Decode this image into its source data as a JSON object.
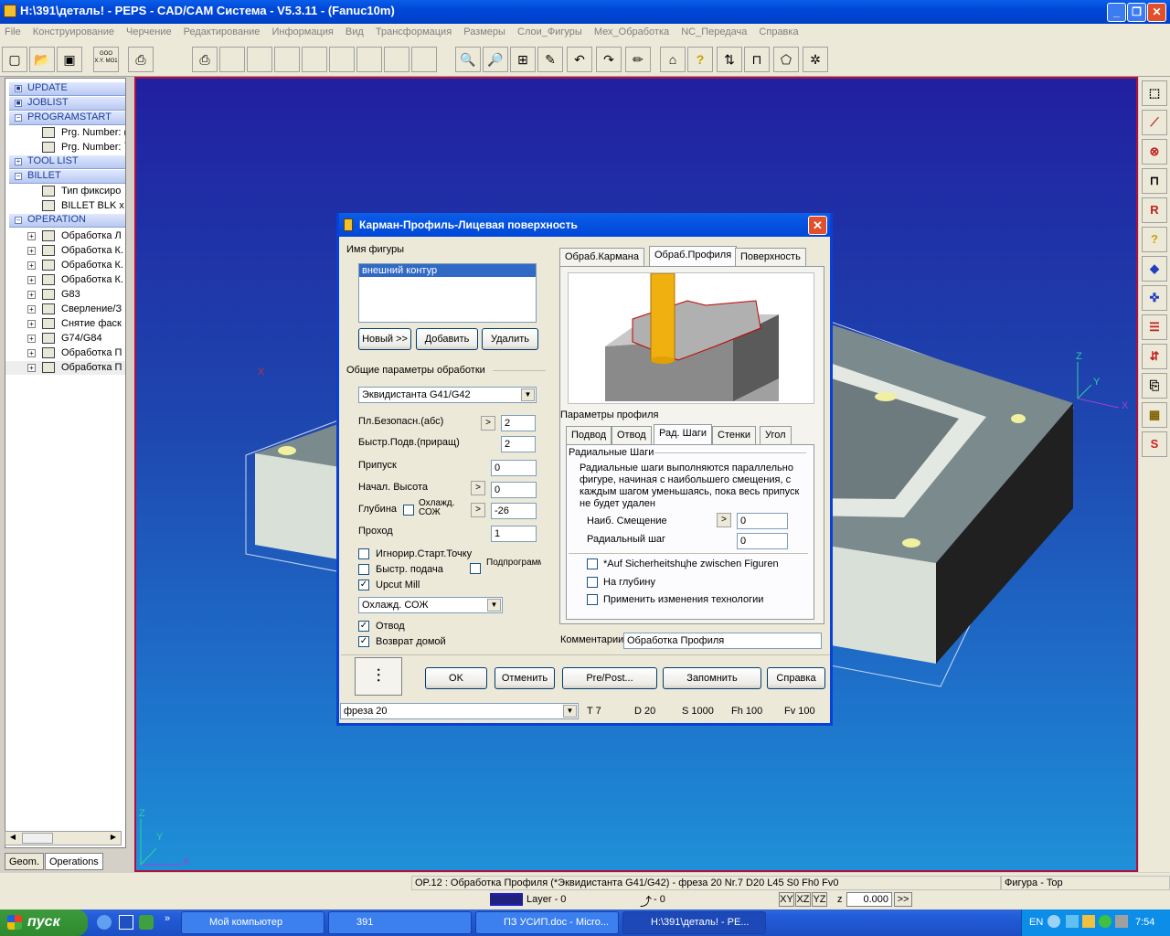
{
  "window": {
    "title": "H:\\391\\деталь! - PEPS - CAD/CAM Система - V5.3.11 - (Fanuc10m)",
    "minimize": "_",
    "maximize": "❐",
    "close": "✕"
  },
  "menu": [
    "File",
    "Конструирование",
    "Черчение",
    "Редактирование",
    "Информация",
    "Вид",
    "Трансформация",
    "Размеры",
    "Слои_Фигуры",
    "Мех_Обработка",
    "NC_Передача",
    "Справка"
  ],
  "toolbar": {
    "goto": "GOO X.Y. MO1"
  },
  "tree": {
    "sections": {
      "update": "UPDATE",
      "joblist": "JOBLIST",
      "programstart": "PROGRAMSTART",
      "toollist": "TOOL LIST",
      "billet": "BILLET",
      "operation": "OPERATION"
    },
    "prog": [
      "Prg. Number: (",
      "Prg. Number: `"
    ],
    "billet": [
      "Тип фиксиро",
      "BILLET BLK x"
    ],
    "ops": [
      "Обработка Л",
      "Обработка К.",
      "Обработка К.",
      "Обработка К.",
      "G83",
      "Сверление/З",
      "Снятие фаск",
      "G74/G84",
      "Обработка П",
      "Обработка П"
    ],
    "tabs": [
      "Geom.",
      "Operations"
    ]
  },
  "viewport": {
    "axes": {
      "z": "Z",
      "y": "Y",
      "x": "X"
    }
  },
  "right_tools": [
    "?"
  ],
  "dialog": {
    "title": "Карман-Профиль-Лицевая поверхность",
    "close": "✕",
    "figure_name_label": "Имя фигуры",
    "figure_list": [
      "внешний контур"
    ],
    "buttons": {
      "new": "Новый >>",
      "add": "Добавить",
      "delete": "Удалить"
    },
    "general_label": "Общие параметры обработки",
    "equidistant": "Эквидистанта  G41/G42",
    "fields": {
      "safe_plane": {
        "label": "Пл.Безопасн.(абс)",
        "value": "2"
      },
      "rapid": {
        "label": "Быстр.Подв.(приращ)",
        "value": "2"
      },
      "allowance": {
        "label": "Припуск",
        "value": "0"
      },
      "start_height": {
        "label": "Начал. Высота",
        "value": "0"
      },
      "depth": {
        "label": "Глубина",
        "value": "-26"
      },
      "pass": {
        "label": "Проход",
        "value": "1"
      }
    },
    "cool_label": "Охлажд. СОЖ",
    "arrow": ">",
    "checks": {
      "ignore_start": "Игнорир.Старт.Точку",
      "fast_feed": "Быстр. подача",
      "subprogram": "Подпрограмма",
      "upcut": "Upcut Mill",
      "retract": "Отвод",
      "home": "Возврат домой"
    },
    "checkmark": "✓",
    "coolant_select": "Охлажд. СОЖ",
    "tabs_main": [
      "Обраб.Кармана",
      "Обраб.Профиля",
      "Поверхность"
    ],
    "profile_params_label": "Параметры профиля",
    "tabs_sub": [
      "Подвод",
      "Отвод",
      "Рад. Шаги",
      "Стенки",
      "Угол"
    ],
    "radial_steps_label": "Радиальные Шаги",
    "radial_description": "Радиальные шаги выполняются параллельно фигуре, начиная с наибольшего смещения, с каждым шагом уменьшаясь, пока весь припуск не будет удален",
    "max_offset": {
      "label": "Наиб. Смещение",
      "value": "0"
    },
    "radial_step": {
      "label": "Радиальный шаг",
      "value": "0"
    },
    "checks2": [
      "*Auf Sicherheitshцhe zwischen Figuren",
      "На глубину",
      "Применить изменения технологии"
    ],
    "comment_label": "Комментарии",
    "comment_value": "Обработка Профиля",
    "bottom_buttons": {
      "ok": "OK",
      "cancel": "Отменить",
      "prepost": "Pre/Post...",
      "save": "Запомнить",
      "help": "Справка"
    },
    "tool_select": "фреза 20",
    "tool_info": [
      "T 7",
      "D 20",
      "S 1000",
      "Fh 100",
      "Fv 100"
    ]
  },
  "status": {
    "op": "OP.12 : Обработка Профиля (*Эквидистанта  G41/G42)   -   фреза 20  Nr.7  D20  L45    S0 Fh0 Fv0",
    "view": "Фигура - Top",
    "layer": "Layer - 0",
    "point": "- 0",
    "xy": "XY",
    "xz": "XZ",
    "yz": "YZ",
    "z": "z",
    "zval": "0.000",
    "more": ">>"
  },
  "taskbar": {
    "start": "пуск",
    "quick": "»",
    "items": [
      "Мой компьютер",
      "391",
      "ПЗ УСИП.doc - Micro...",
      "H:\\391\\деталь! - PE..."
    ],
    "lang": "EN",
    "time": "7:54"
  }
}
